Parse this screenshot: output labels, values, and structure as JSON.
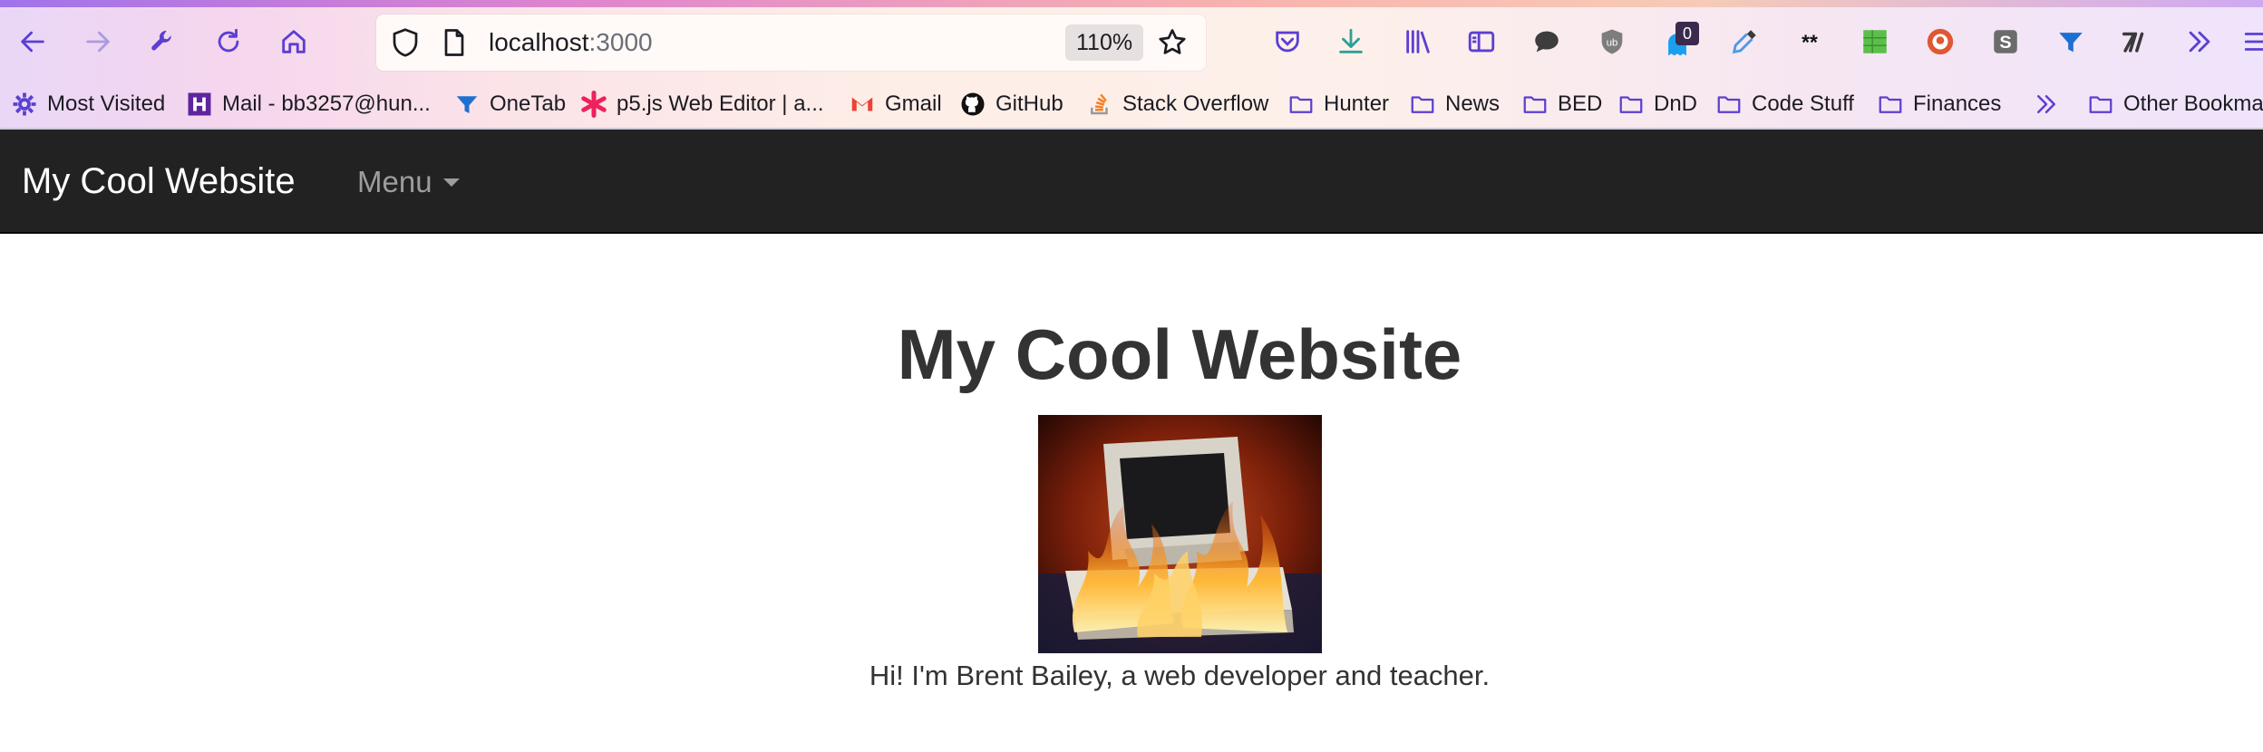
{
  "browser": {
    "url_host": "localhost",
    "url_port": ":3000",
    "zoom": "110%",
    "extensions_badge": "0",
    "accent_color": "#5b3fd1",
    "bookmarks": [
      {
        "label": "Most Visited",
        "icon": "gear-icon"
      },
      {
        "label": "Mail - bb3257@hun...",
        "icon": "hunter-h-icon"
      },
      {
        "label": "OneTab",
        "icon": "onetab-icon"
      },
      {
        "label": "p5.js Web Editor | a...",
        "icon": "asterisk-icon"
      },
      {
        "label": "Gmail",
        "icon": "gmail-icon"
      },
      {
        "label": "GitHub",
        "icon": "github-icon"
      },
      {
        "label": "Stack Overflow",
        "icon": "stackoverflow-icon"
      },
      {
        "label": "Hunter",
        "icon": "folder-icon"
      },
      {
        "label": "News",
        "icon": "folder-icon"
      },
      {
        "label": "BED",
        "icon": "folder-icon"
      },
      {
        "label": "DnD",
        "icon": "folder-icon"
      },
      {
        "label": "Code Stuff",
        "icon": "folder-icon"
      },
      {
        "label": "Finances",
        "icon": "folder-icon"
      },
      {
        "label": "Other Bookmar",
        "icon": "folder-icon"
      }
    ]
  },
  "navbar": {
    "brand": "My Cool Website",
    "menu_label": "Menu",
    "background": "#222222"
  },
  "main": {
    "title": "My Cool Website",
    "image_alt": "burning computer",
    "intro": "Hi! I'm Brent Bailey, a web developer and teacher."
  }
}
